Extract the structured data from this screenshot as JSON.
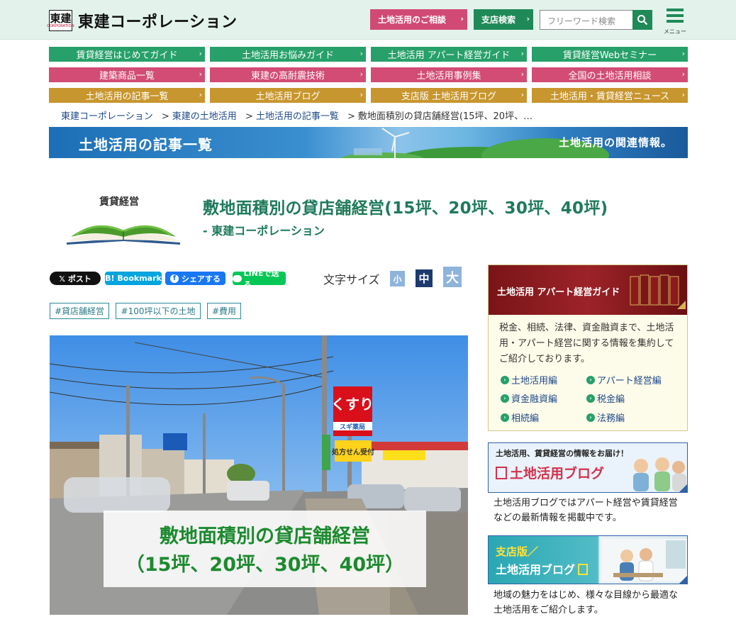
{
  "header": {
    "logo_mark": "東建",
    "logo_mark_sub": "CORPORATION",
    "logo_text": "東建コーポレーション",
    "consult_label": "土地活用のご相談",
    "branch_search_label": "支店検索",
    "search_placeholder": "フリーワード検索",
    "menu_label": "メニュー"
  },
  "nav": {
    "row1": [
      "賃貸経営はじめてガイド",
      "土地活用お悩みガイド",
      "土地活用 アパート経営ガイド",
      "賃貸経営Webセミナー"
    ],
    "row2": [
      "建築商品一覧",
      "東建の高耐震技術",
      "土地活用事例集",
      "全国の土地活用相談"
    ],
    "row3": [
      "土地活用の記事一覧",
      "土地活用ブログ",
      "支店版 土地活用ブログ",
      "土地活用・賃貸経営ニュース"
    ]
  },
  "breadcrumb": {
    "items": [
      "東建コーポレーション",
      "東建の土地活用",
      "土地活用の記事一覧"
    ],
    "current": "敷地面積別の貸店舗経営(15坪、20坪、…",
    "separator": ">"
  },
  "banner": {
    "title": "土地活用の記事一覧",
    "subtitle": "土地活用の関連情報。"
  },
  "article": {
    "category": "賃貸経営",
    "title": "敷地面積別の貸店舗経営(15坪、20坪、30坪、40坪)",
    "author": "- 東建コーポレーション",
    "hero_caption_line1": "敷地面積別の貸店舗経営",
    "hero_caption_line2": "（15坪、20坪、30坪、40坪）",
    "hero_sign1": "くすり",
    "hero_sign2": "スギ薬局",
    "hero_sign3": "処方せん受付"
  },
  "share": {
    "x": "𝕏 ポスト",
    "hatena": "B! Bookmark",
    "facebook": "シェアする",
    "line": "LINEで送る"
  },
  "font_size": {
    "label": "文字サイズ",
    "small": "小",
    "medium": "中",
    "large": "大"
  },
  "tags": [
    "#貸店舗経営",
    "#100坪以下の土地",
    "#費用"
  ],
  "sidebar": {
    "guide": {
      "title": "土地活用 アパート経営ガイド",
      "description": "税金、相続、法律、資金融資まで、土地活用・アパート経営に関する情報を集約してご紹介しております。",
      "links": [
        "土地活用編",
        "アパート経営編",
        "資金融資編",
        "税金編",
        "相続編",
        "法務編"
      ]
    },
    "blog": {
      "top": "土地活用、賃貸経営の情報をお届け！",
      "title": "土地活用ブログ",
      "description": "土地活用ブログではアパート経営や賃貸経営などの最新情報を掲載中です。"
    },
    "branch_blog": {
      "line1": "支店版／",
      "line2": "土地活用ブログ",
      "description": "地域の魅力をはじめ、様々な目線から最適な土地活用をご紹介します。"
    }
  },
  "colors": {
    "brand_green": "#1f8a57",
    "nav_green": "#27a06a",
    "nav_pink": "#d24c76",
    "nav_gold": "#c8962e",
    "title_green": "#1f7a5a"
  }
}
